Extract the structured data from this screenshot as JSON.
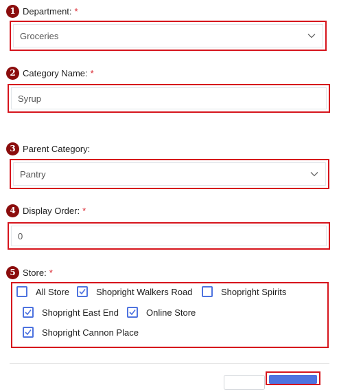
{
  "form": {
    "department": {
      "badge": "1",
      "label": "Department:",
      "required": "*",
      "value": "Groceries"
    },
    "category_name": {
      "badge": "2",
      "label": "Category Name:",
      "required": "*",
      "value": "Syrup"
    },
    "parent_category": {
      "badge": "3",
      "label": "Parent Category:",
      "value": "Pantry"
    },
    "display_order": {
      "badge": "4",
      "label": "Display Order:",
      "required": "*",
      "value": "0"
    },
    "store": {
      "badge": "5",
      "label": "Store:",
      "required": "*",
      "options": [
        {
          "label": "All Store",
          "checked": false
        },
        {
          "label": "Shopright Walkers Road",
          "checked": true
        },
        {
          "label": "Shopright Spirits",
          "checked": false
        },
        {
          "label": "Shopright East End",
          "checked": true
        },
        {
          "label": "Online Store",
          "checked": true
        },
        {
          "label": "Shopright Cannon Place",
          "checked": true
        }
      ]
    }
  },
  "colors": {
    "highlight": "#d6141c",
    "checkbox": "#4e73df",
    "badge": "#8b0d0d",
    "required": "#d9232d"
  }
}
